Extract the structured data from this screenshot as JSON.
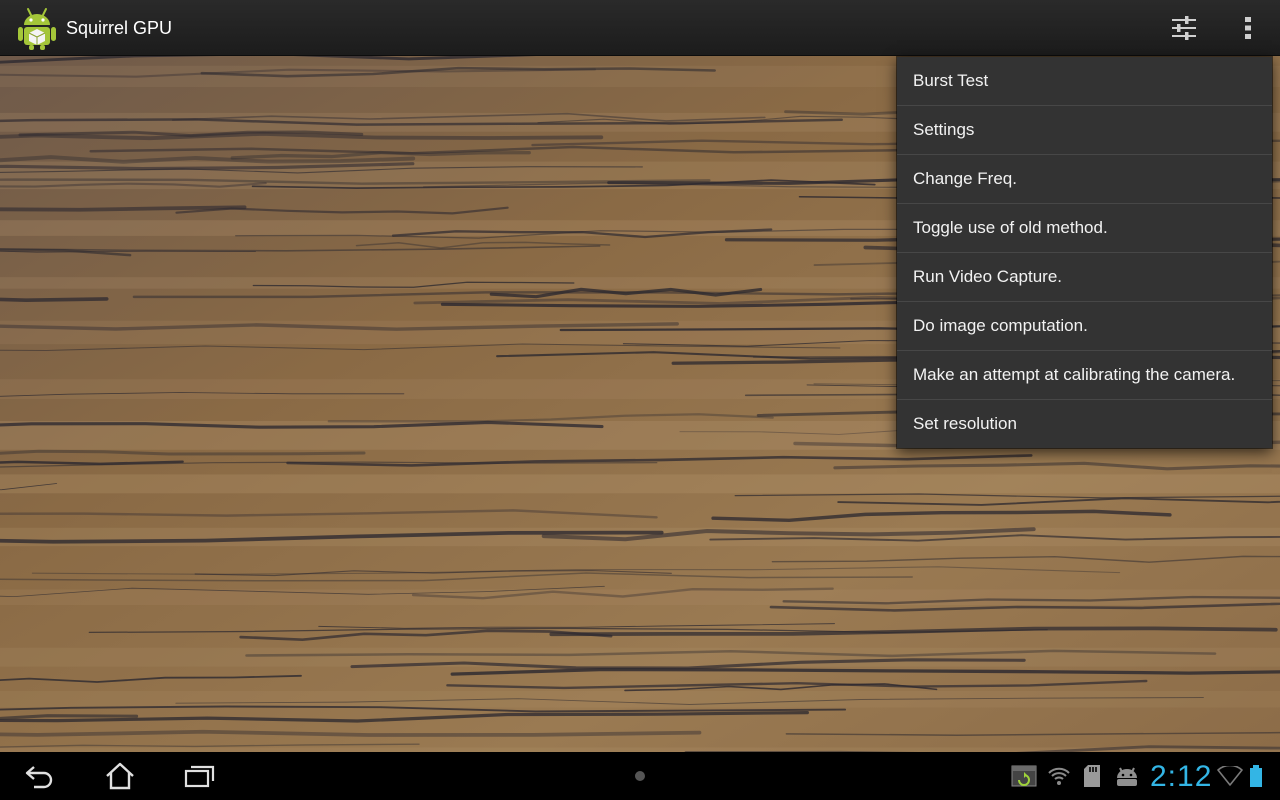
{
  "app": {
    "title": "Squirrel GPU",
    "icon": "android-robot-icon"
  },
  "action_bar": {
    "actions": [
      {
        "name": "tune-settings",
        "icon": "sliders-icon"
      },
      {
        "name": "overflow-menu",
        "icon": "vertical-dots-icon"
      }
    ]
  },
  "menu": {
    "items": [
      {
        "label": "Burst Test"
      },
      {
        "label": "Settings"
      },
      {
        "label": "Change Freq."
      },
      {
        "label": "Toggle use of old method."
      },
      {
        "label": "Run Video Capture."
      },
      {
        "label": "Do image computation."
      },
      {
        "label": "Make an attempt at calibrating the camera."
      },
      {
        "label": "Set resolution"
      }
    ]
  },
  "preview": {
    "content": "camera-preview",
    "colors": {
      "base": "#8a6a45",
      "grain": "#2e2a30",
      "highlight": "#b99b74"
    }
  },
  "system_bar": {
    "nav": [
      {
        "name": "back",
        "icon": "back-arrow-icon"
      },
      {
        "name": "home",
        "icon": "home-icon"
      },
      {
        "name": "recent-apps",
        "icon": "recent-apps-icon"
      }
    ],
    "status_icons": [
      "screenshot-notification-icon",
      "wifi-notification-icon",
      "sd-card-icon",
      "android-debug-icon",
      "wifi-signal-icon",
      "battery-icon"
    ],
    "clock": "2:12",
    "accent_color": "#33b5e5"
  }
}
